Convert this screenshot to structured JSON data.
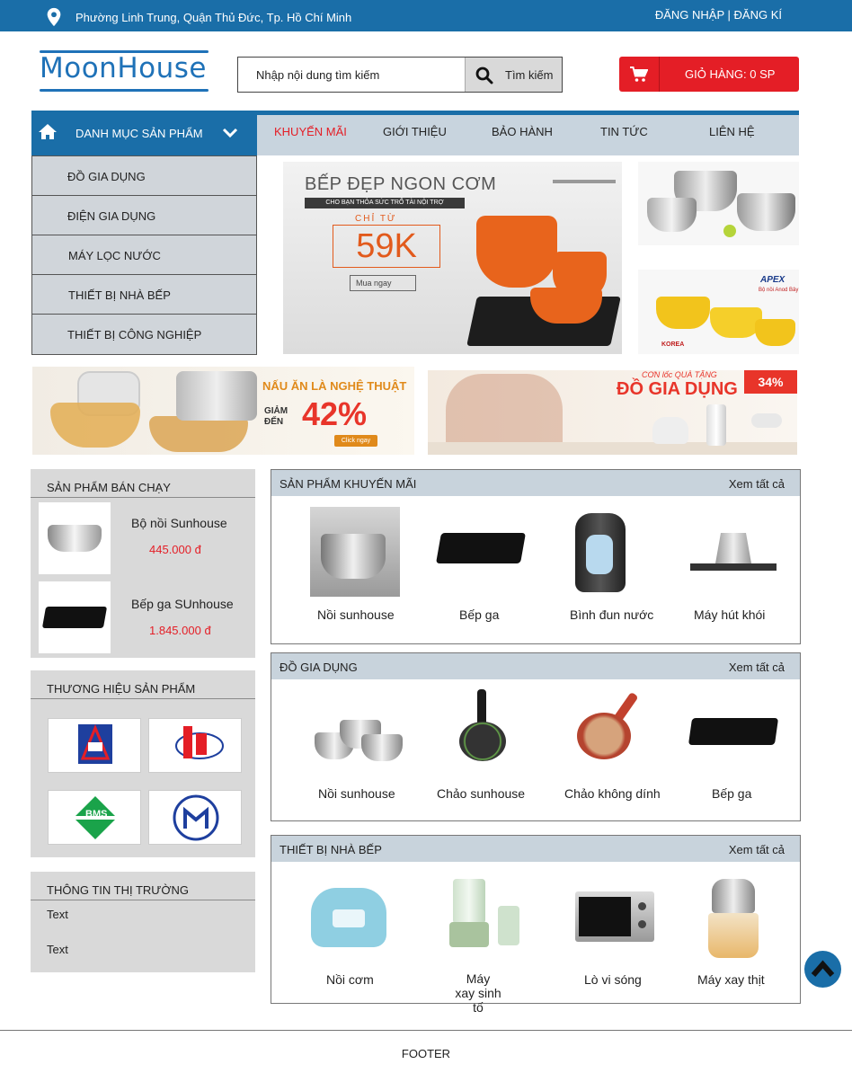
{
  "topbar": {
    "address": "Phường Linh Trung, Quận Thủ Đức, Tp. Hồ Chí Minh",
    "login": "ĐĂNG NHẬP",
    "separator": "|",
    "register": "ĐĂNG KÍ"
  },
  "header": {
    "logo": "MoonHouse",
    "search_placeholder": "Nhập nội dung tìm kiếm",
    "search_button": "Tìm kiếm",
    "cart_label": "GIỎ HÀNG: 0 SP"
  },
  "nav": {
    "category_label": "DANH MỤC SẢN PHẨM",
    "items": [
      "KHUYẾN MÃI",
      "GIỚI THIỆU",
      "BẢO HÀNH",
      "TIN TỨC",
      "LIÊN HỆ"
    ]
  },
  "categories": [
    "ĐỒ GIA DỤNG",
    "ĐIỆN GIA DỤNG",
    "MÁY LỌC NƯỚC",
    "THIẾT BỊ NHÀ BẾP",
    "THIẾT  BỊ CÔNG NGHIỆP"
  ],
  "banners": {
    "main_title": "BẾP ĐẸP NGON CƠM",
    "main_sub": "CHO BẠN THỎA SỨC TRỔ TÀI NỘI TRỢ",
    "main_from": "CHỈ TỪ",
    "main_price": "59K",
    "main_cta": "Mua ngay",
    "side_bottom_brand": "APEX",
    "side_bottom_text": "Bộ nồi Anod Bảy",
    "side_bottom_origin": "KOREA",
    "wide_left_title": "NẤU ĂN LÀ NGHỆ THUẬT",
    "wide_left_discount_label": "GIẢM ĐẾN",
    "wide_left_discount": "42%",
    "wide_left_cta": "Click ngay",
    "wide_right_sub": "CƠN lốc QUÀ TẶNG",
    "wide_right_title": "ĐỒ GIA DỤNG",
    "wide_right_badge": "34%"
  },
  "best_sellers": {
    "title": "SẢN PHẨM BÁN CHẠY",
    "items": [
      {
        "name": "Bộ nồi Sunhouse",
        "price": "445.000 đ"
      },
      {
        "name": "Bếp ga SUnhouse",
        "price": "1.845.000 đ"
      }
    ]
  },
  "brands": {
    "title": "THƯƠNG HIỆU SẢN PHẨM",
    "logo_bms": "BMS"
  },
  "market": {
    "title": "THÔNG TIN THỊ TRƯỜNG",
    "items": [
      "Text",
      "Text"
    ]
  },
  "sections": [
    {
      "title": "SẢN PHẨM KHUYẾN MÃI",
      "more": "Xem tất cả",
      "products": [
        "Nồi sunhouse",
        "Bếp ga",
        "Bình đun nước",
        "Máy hút khói"
      ]
    },
    {
      "title": "ĐỒ GIA DỤNG",
      "more": "Xem tất cả",
      "products": [
        "Nồi sunhouse",
        "Chảo sunhouse",
        "Chảo không dính",
        "Bếp ga"
      ]
    },
    {
      "title": "THIẾT BỊ NHÀ BẾP",
      "more": "Xem tất cả",
      "products": [
        "Nồi cơm",
        "Máy xay sinh tố",
        "Lò vi sóng",
        "Máy xay thịt"
      ]
    }
  ],
  "footer": "FOOTER",
  "colors": {
    "primary": "#1a6ea8",
    "accent": "#e41e26",
    "nav_bg": "#c8d4de",
    "panel_bg": "#d9d9d9"
  }
}
